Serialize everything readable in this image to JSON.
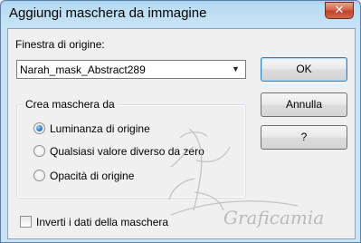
{
  "window": {
    "title": "Aggiungi maschera da immagine",
    "close_label": "✕"
  },
  "source": {
    "label": "Finestra di origine:",
    "selected": "Narah_mask_Abstract289"
  },
  "buttons": {
    "ok": "OK",
    "cancel": "Annulla",
    "help": "?"
  },
  "mask_group": {
    "legend": "Crea maschera da",
    "options": [
      {
        "label": "Luminanza di origine",
        "checked": true
      },
      {
        "label": "Qualsiasi valore diverso da zero",
        "checked": false
      },
      {
        "label": "Opacità di origine",
        "checked": false
      }
    ]
  },
  "invert": {
    "label": "Inverti i dati della maschera",
    "checked": false
  },
  "watermark": {
    "text": "Graficamia"
  }
}
